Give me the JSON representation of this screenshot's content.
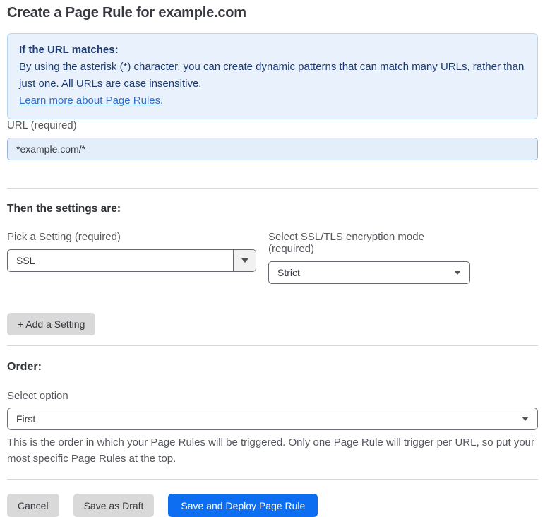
{
  "page": {
    "title": "Create a Page Rule for example.com"
  },
  "info_box": {
    "heading": "If the URL matches:",
    "body": "By using the asterisk (*) character, you can create dynamic patterns that can match many URLs, rather than just one. All URLs are case insensitive.",
    "link_label": "Learn more about Page Rules",
    "link_suffix": "."
  },
  "url_field": {
    "label": "URL (required)",
    "value": "*example.com/*"
  },
  "settings": {
    "heading": "Then the settings are:",
    "setting_label": "Pick a Setting (required)",
    "setting_value": "SSL",
    "mode_label": "Select SSL/TLS encryption mode (required)",
    "mode_value": "Strict",
    "add_button": "+ Add a Setting"
  },
  "order": {
    "heading": "Order:",
    "select_label": "Select option",
    "select_value": "First",
    "help_text": "This is the order in which your Page Rules will be triggered. Only one Page Rule will trigger per URL, so put your most specific Page Rules at the top."
  },
  "footer": {
    "cancel": "Cancel",
    "save_draft": "Save as Draft",
    "save_deploy": "Save and Deploy Page Rule"
  },
  "colors": {
    "accent_blue": "#0d6ef2",
    "info_background": "#e9f2fc",
    "info_border": "#b5d8f2",
    "info_text": "#1d3b72",
    "link_blue": "#2e6fd2",
    "input_background": "#e4eefb",
    "button_gray": "#d9d9d9",
    "divider_gray": "#d8d8d8"
  }
}
